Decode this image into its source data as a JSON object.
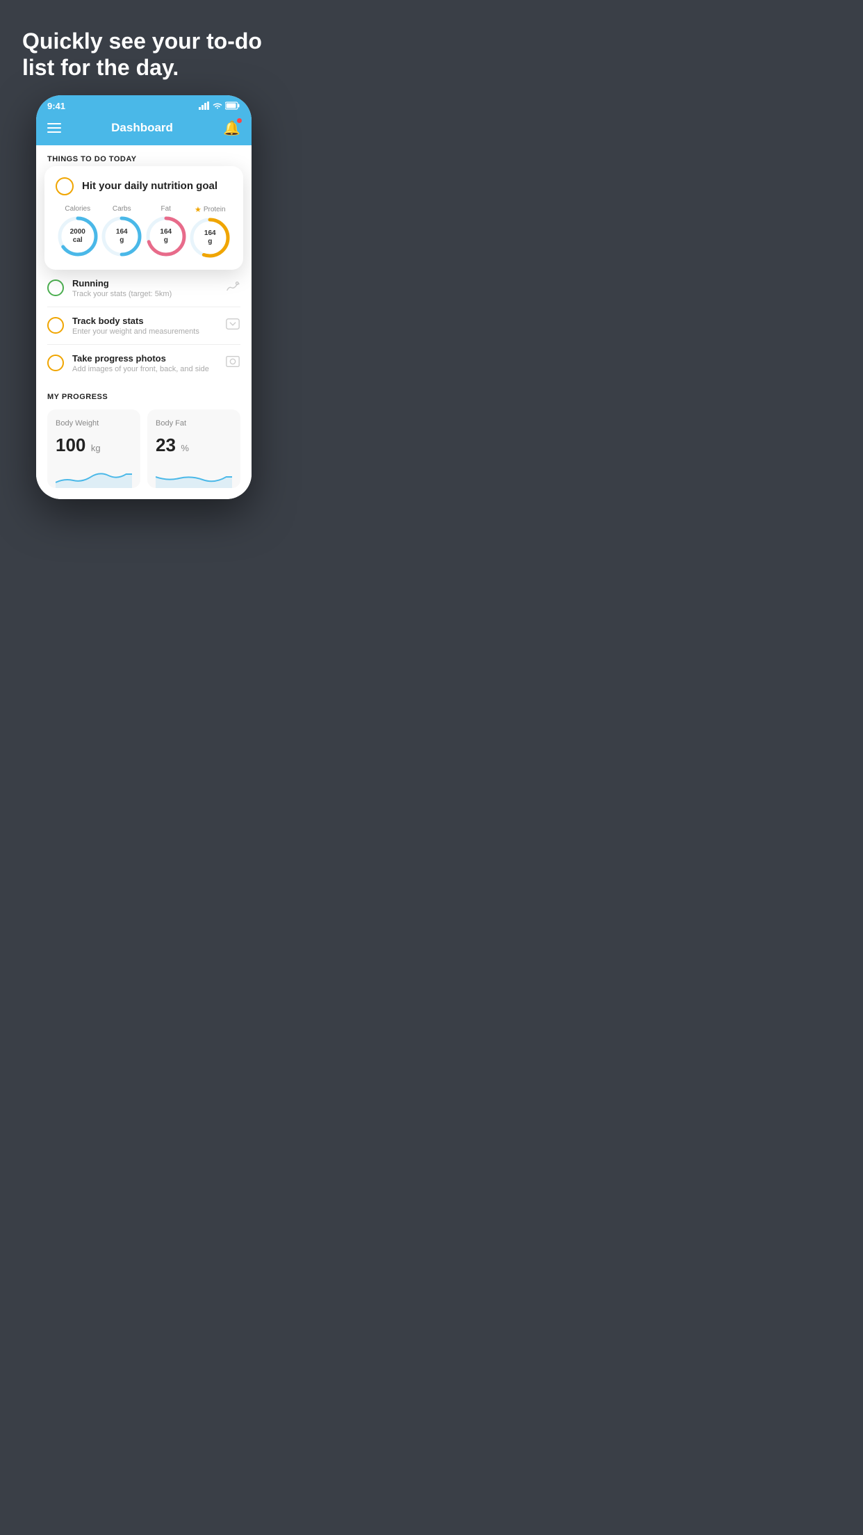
{
  "hero": {
    "title": "Quickly see your to-do list for the day."
  },
  "statusBar": {
    "time": "9:41",
    "icons": "▌▌▌ ))) 🔋"
  },
  "navBar": {
    "title": "Dashboard"
  },
  "thingsToday": {
    "header": "THINGS TO DO TODAY"
  },
  "nutritionCard": {
    "title": "Hit your daily nutrition goal",
    "items": [
      {
        "label": "Calories",
        "value": "2000",
        "unit": "cal",
        "color": "#4ab8e8",
        "percent": 65,
        "star": false
      },
      {
        "label": "Carbs",
        "value": "164",
        "unit": "g",
        "color": "#4ab8e8",
        "percent": 50,
        "star": false
      },
      {
        "label": "Fat",
        "value": "164",
        "unit": "g",
        "color": "#e86b8a",
        "percent": 70,
        "star": false
      },
      {
        "label": "Protein",
        "value": "164",
        "unit": "g",
        "color": "#f0a500",
        "percent": 55,
        "star": true
      }
    ]
  },
  "todoItems": [
    {
      "title": "Running",
      "subtitle": "Track your stats (target: 5km)",
      "checkColor": "green",
      "icon": "👟"
    },
    {
      "title": "Track body stats",
      "subtitle": "Enter your weight and measurements",
      "checkColor": "yellow",
      "icon": "⚖️"
    },
    {
      "title": "Take progress photos",
      "subtitle": "Add images of your front, back, and side",
      "checkColor": "yellow",
      "icon": "🖼️"
    }
  ],
  "myProgress": {
    "header": "MY PROGRESS",
    "cards": [
      {
        "title": "Body Weight",
        "value": "100",
        "unit": "kg"
      },
      {
        "title": "Body Fat",
        "value": "23",
        "unit": "%"
      }
    ]
  }
}
